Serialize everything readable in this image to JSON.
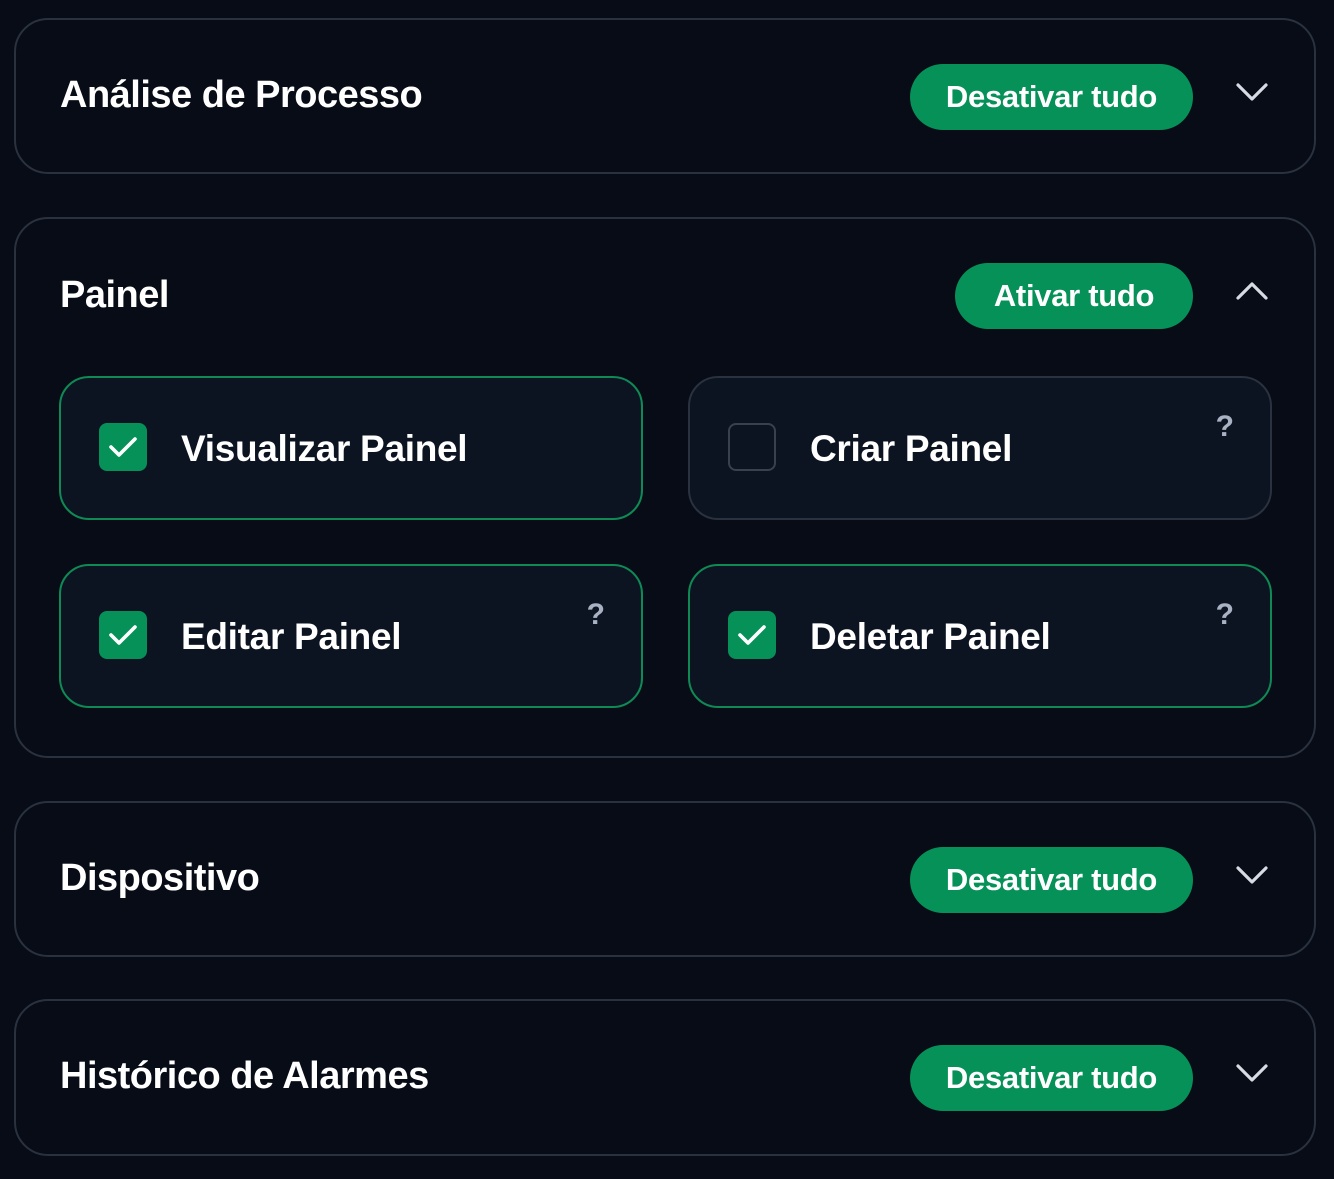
{
  "sections": [
    {
      "title": "Análise de Processo",
      "button_label": "Desativar tudo",
      "chevron_icon": "chevron-down-icon",
      "expanded": false
    },
    {
      "title": "Painel",
      "button_label": "Ativar tudo",
      "chevron_icon": "chevron-up-icon",
      "expanded": true,
      "permissions": [
        {
          "label": "Visualizar Painel",
          "checked": true,
          "help": ""
        },
        {
          "label": "Criar Painel",
          "checked": false,
          "help": "?"
        },
        {
          "label": "Editar Painel",
          "checked": true,
          "help": "?"
        },
        {
          "label": "Deletar Painel",
          "checked": true,
          "help": "?"
        }
      ]
    },
    {
      "title": "Dispositivo",
      "button_label": "Desativar tudo",
      "chevron_icon": "chevron-down-icon",
      "expanded": false
    },
    {
      "title": "Histórico de Alarmes",
      "button_label": "Desativar tudo",
      "chevron_icon": "chevron-down-icon",
      "expanded": false
    }
  ],
  "colors": {
    "background": "#070c16",
    "accent": "#069158",
    "card_border": "#2a323f",
    "checked_border": "#0f8a55",
    "help_text": "#a9b2c3"
  }
}
